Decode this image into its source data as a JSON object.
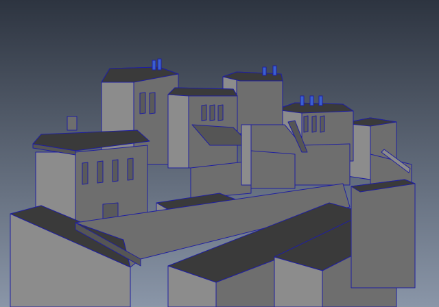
{
  "viewport": {
    "background_top": "#2d3440",
    "background_bottom": "#8a96a8",
    "mesh_color_light": "#8c8c8c",
    "mesh_color_mid": "#6e6e6e",
    "mesh_color_dark": "#555555",
    "mesh_color_top": "#3a3a3a",
    "wireframe_color": "#1f1fa0"
  }
}
